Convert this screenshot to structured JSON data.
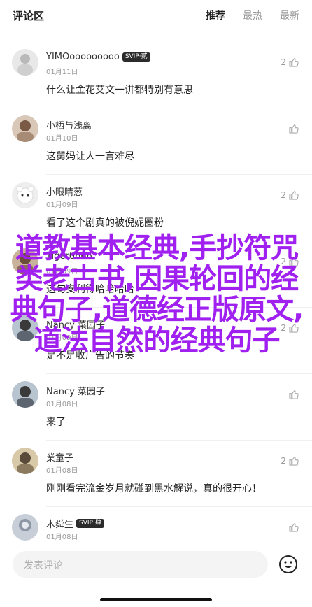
{
  "header": {
    "title": "评论区",
    "tabs": [
      {
        "label": "推荐",
        "active": true
      },
      {
        "label": "最热",
        "active": false
      },
      {
        "label": "最新",
        "active": false
      }
    ]
  },
  "comments": [
    {
      "name": "YIMOooooooooo",
      "badge": "SVIP·贰",
      "date": "01月11日",
      "text": "什么让金花艾文一讲都特别有意思",
      "likes": "2"
    },
    {
      "name": "小栖与浅离",
      "badge": "",
      "date": "01月10日",
      "text": "这舅妈让人一言难尽",
      "likes": ""
    },
    {
      "name": "小眼睛葱",
      "badge": "",
      "date": "01月09日",
      "text": "看了这个剧真的被倪妮圈粉",
      "likes": "2"
    },
    {
      "name": "Tiger0666",
      "badge": "",
      "date": "01月09日",
      "text": "这句安利得哈哈哈哈",
      "likes": "2"
    },
    {
      "name": "Nancy 菜园子",
      "badge": "",
      "date": "01月09日",
      "text": "是不是收广告的节奏",
      "likes": "2"
    },
    {
      "name": "Nancy 菜园子",
      "badge": "",
      "date": "01月08日",
      "text": "来了",
      "likes": ""
    },
    {
      "name": "業童子",
      "badge": "",
      "date": "01月08日",
      "text": "刚刚看完流金岁月就碰到黑水解说，真的很开心！",
      "likes": "2"
    },
    {
      "name": "木舜生",
      "badge": "SVIP·肆",
      "date": "01月08日",
      "text": "",
      "likes": ""
    }
  ],
  "overlay_title": "道教基本经典,手抄符咒类老古书,因果轮回的经典句子,道德经正版原文,道法自然的经典句子",
  "input": {
    "placeholder": "发表评论"
  },
  "colors": {
    "overlay": "#a020f0",
    "badge_bg": "#2b2b2b"
  }
}
